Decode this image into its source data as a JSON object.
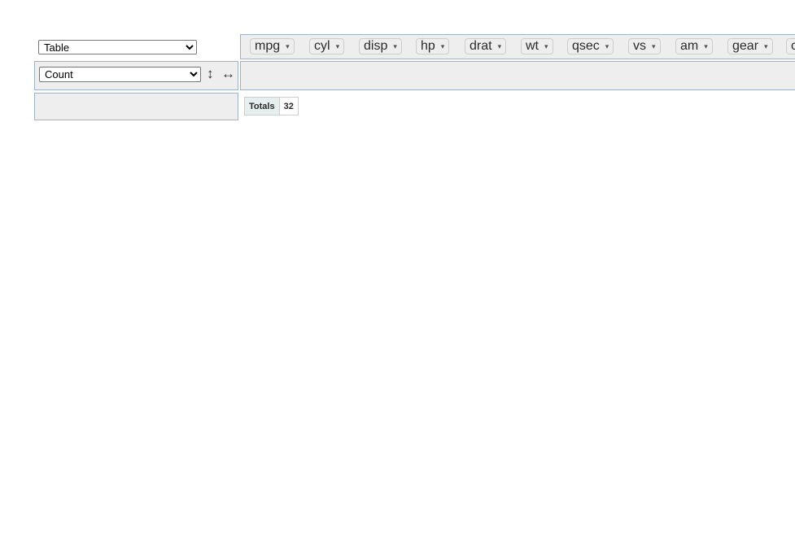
{
  "renderer": {
    "selected": "Table",
    "options": [
      "Table"
    ]
  },
  "aggregator": {
    "selected": "Count",
    "options": [
      "Count"
    ],
    "row_order_icon": "↕",
    "col_order_icon": "↔"
  },
  "attributes": [
    {
      "label": "mpg",
      "arrow": "▾"
    },
    {
      "label": "cyl",
      "arrow": "▾"
    },
    {
      "label": "disp",
      "arrow": "▾"
    },
    {
      "label": "hp",
      "arrow": "▾"
    },
    {
      "label": "drat",
      "arrow": "▾"
    },
    {
      "label": "wt",
      "arrow": "▾"
    },
    {
      "label": "qsec",
      "arrow": "▾"
    },
    {
      "label": "vs",
      "arrow": "▾"
    },
    {
      "label": "am",
      "arrow": "▾"
    },
    {
      "label": "gear",
      "arrow": "▾"
    },
    {
      "label": "c",
      "arrow": ""
    }
  ],
  "table": {
    "totals_label": "Totals",
    "totals_value": "32"
  },
  "colors": {
    "panel_bg": "#eeeeee",
    "panel_border": "#a2b1c6",
    "header_bg": "#e6eeee"
  }
}
